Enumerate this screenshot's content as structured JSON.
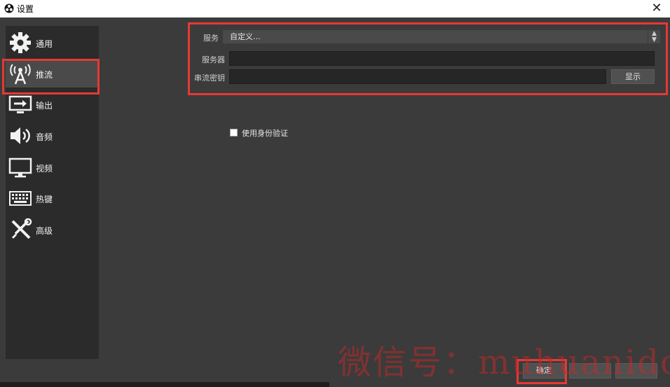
{
  "window": {
    "title": "设置",
    "close_glyph": "✕"
  },
  "sidebar": {
    "items": [
      {
        "label": "通用",
        "icon": "gear-icon"
      },
      {
        "label": "推流",
        "icon": "broadcast-antenna-icon",
        "selected": true
      },
      {
        "label": "输出",
        "icon": "output-monitor-icon"
      },
      {
        "label": "音频",
        "icon": "speaker-icon"
      },
      {
        "label": "视频",
        "icon": "monitor-icon"
      },
      {
        "label": "热键",
        "icon": "keyboard-icon"
      },
      {
        "label": "高级",
        "icon": "tools-icon"
      }
    ]
  },
  "stream": {
    "service_label": "服务",
    "service_value": "自定义...",
    "server_label": "服务器",
    "server_value": "",
    "key_label": "串流密钥",
    "key_value": "",
    "show_button": "显示",
    "auth_checkbox_label": "使用身份验证",
    "auth_checked": false
  },
  "footer": {
    "ok_button": "确定"
  },
  "watermark": "微信号：muhuanidc",
  "colors": {
    "highlight": "#e53935",
    "panel": "#3b3b3b",
    "sidebar": "#2b2b2b"
  }
}
